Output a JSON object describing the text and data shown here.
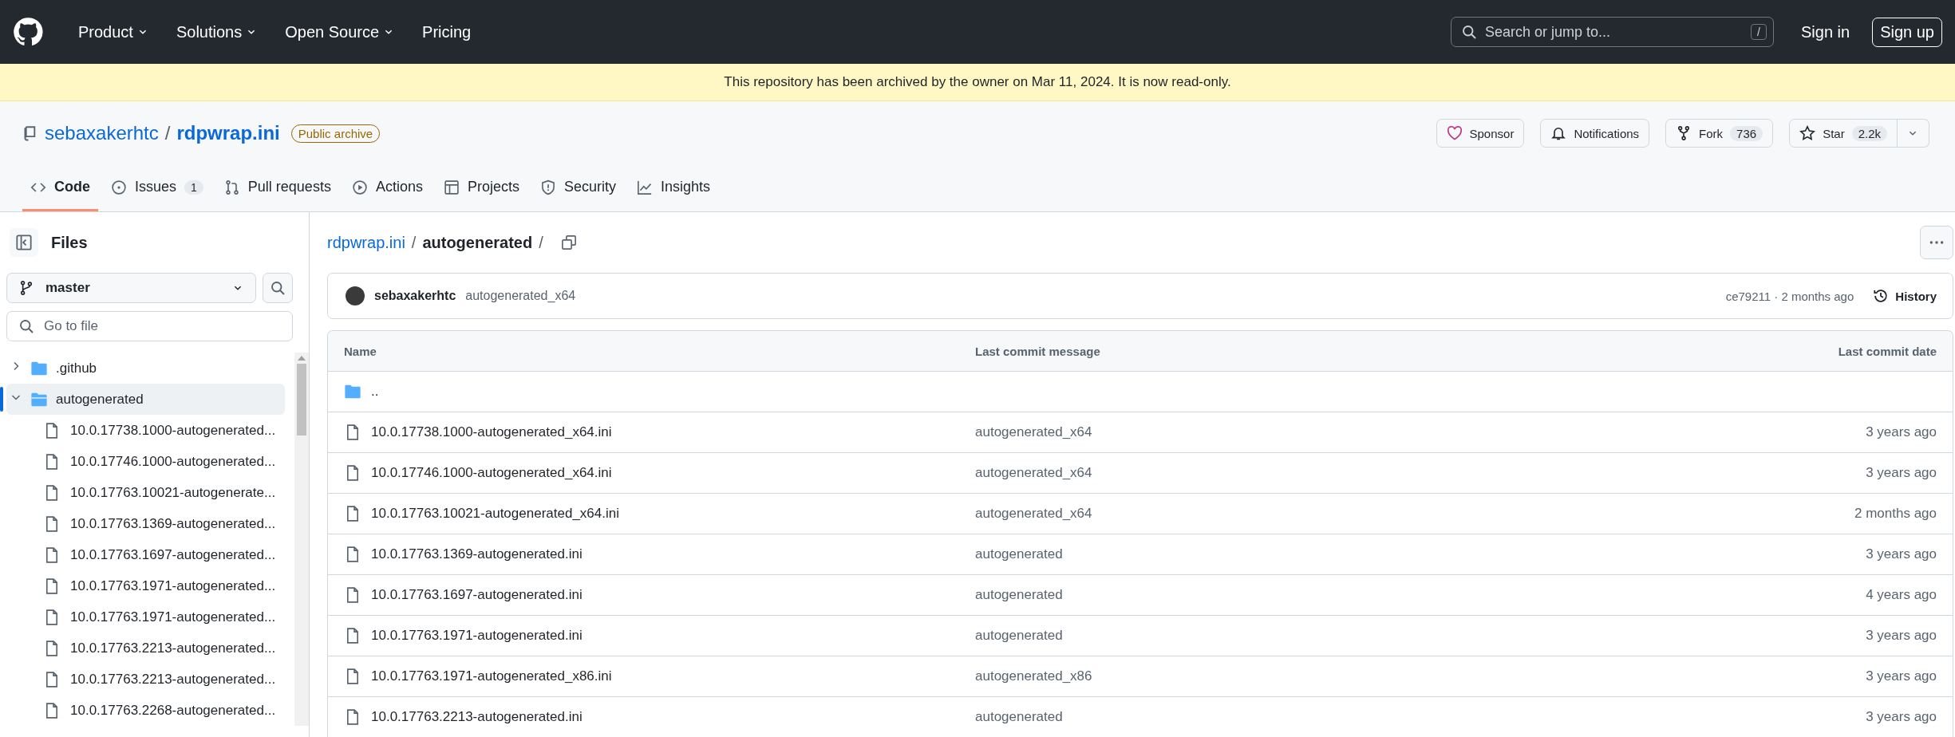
{
  "top_nav": {
    "menu": [
      {
        "label": "Product",
        "dropdown": true
      },
      {
        "label": "Solutions",
        "dropdown": true
      },
      {
        "label": "Open Source",
        "dropdown": true
      },
      {
        "label": "Pricing",
        "dropdown": false
      }
    ],
    "search": {
      "placeholder": "Search or jump to...",
      "shortcut": "/"
    },
    "sign_in": "Sign in",
    "sign_up": "Sign up"
  },
  "banner": "This repository has been archived by the owner on Mar 11, 2024. It is now read-only.",
  "repo": {
    "owner": "sebaxakerhtc",
    "separator": "/",
    "name": "rdpwrap.ini",
    "badge": "Public archive",
    "actions": [
      {
        "kind": "sponsor",
        "label": "Sponsor"
      },
      {
        "kind": "notifications",
        "label": "Notifications"
      },
      {
        "kind": "fork",
        "label": "Fork",
        "count": "736"
      },
      {
        "kind": "star",
        "label": "Star",
        "count": "2.2k"
      }
    ]
  },
  "tabs": [
    {
      "kind": "code",
      "label": "Code",
      "selected": true
    },
    {
      "kind": "issues",
      "label": "Issues",
      "count": "1",
      "selected": false
    },
    {
      "kind": "pulls",
      "label": "Pull requests",
      "selected": false
    },
    {
      "kind": "actions",
      "label": "Actions",
      "selected": false
    },
    {
      "kind": "projects",
      "label": "Projects",
      "selected": false
    },
    {
      "kind": "security",
      "label": "Security",
      "selected": false
    },
    {
      "kind": "insights",
      "label": "Insights",
      "selected": false
    }
  ],
  "sidebar": {
    "title": "Files",
    "branch": "master",
    "filter_placeholder": "Go to file",
    "tree": [
      {
        "kind": "folder",
        "label": ".github",
        "expanded": false,
        "selected": false
      },
      {
        "kind": "folder",
        "label": "autogenerated",
        "expanded": true,
        "selected": true,
        "children": [
          {
            "kind": "file",
            "label": "10.0.17738.1000-autogenerated...",
            "selected": false
          },
          {
            "kind": "file",
            "label": "10.0.17746.1000-autogenerated...",
            "selected": false
          },
          {
            "kind": "file",
            "label": "10.0.17763.10021-autogenerate...",
            "selected": false
          },
          {
            "kind": "file",
            "label": "10.0.17763.1369-autogenerated...",
            "selected": false
          },
          {
            "kind": "file",
            "label": "10.0.17763.1697-autogenerated...",
            "selected": false
          },
          {
            "kind": "file",
            "label": "10.0.17763.1971-autogenerated...",
            "selected": false
          },
          {
            "kind": "file",
            "label": "10.0.17763.1971-autogenerated...",
            "selected": false
          },
          {
            "kind": "file",
            "label": "10.0.17763.2213-autogenerated...",
            "selected": false
          },
          {
            "kind": "file",
            "label": "10.0.17763.2213-autogenerated...",
            "selected": false
          },
          {
            "kind": "file",
            "label": "10.0.17763.2268-autogenerated...",
            "selected": false
          }
        ]
      }
    ]
  },
  "breadcrumb": {
    "root": "rdpwrap.ini",
    "path": "autogenerated",
    "separator": "/"
  },
  "latest_commit": {
    "author": "sebaxakerhtc",
    "message": "autogenerated_x64",
    "hash_time": "ce79211 · 2 months ago",
    "history": "History"
  },
  "table": {
    "columns": [
      "Name",
      "Last commit message",
      "Last commit date"
    ],
    "rows": [
      {
        "kind": "parent",
        "name": ".."
      },
      {
        "kind": "file",
        "name": "10.0.17738.1000-autogenerated_x64.ini",
        "message": "autogenerated_x64",
        "date": "3 years ago"
      },
      {
        "kind": "file",
        "name": "10.0.17746.1000-autogenerated_x64.ini",
        "message": "autogenerated_x64",
        "date": "3 years ago"
      },
      {
        "kind": "file",
        "name": "10.0.17763.10021-autogenerated_x64.ini",
        "message": "autogenerated_x64",
        "date": "2 months ago"
      },
      {
        "kind": "file",
        "name": "10.0.17763.1369-autogenerated.ini",
        "message": "autogenerated",
        "date": "3 years ago"
      },
      {
        "kind": "file",
        "name": "10.0.17763.1697-autogenerated.ini",
        "message": "autogenerated",
        "date": "4 years ago"
      },
      {
        "kind": "file",
        "name": "10.0.17763.1971-autogenerated.ini",
        "message": "autogenerated",
        "date": "3 years ago"
      },
      {
        "kind": "file",
        "name": "10.0.17763.1971-autogenerated_x86.ini",
        "message": "autogenerated_x86",
        "date": "3 years ago"
      },
      {
        "kind": "file",
        "name": "10.0.17763.2213-autogenerated.ini",
        "message": "autogenerated",
        "date": "3 years ago"
      }
    ]
  }
}
